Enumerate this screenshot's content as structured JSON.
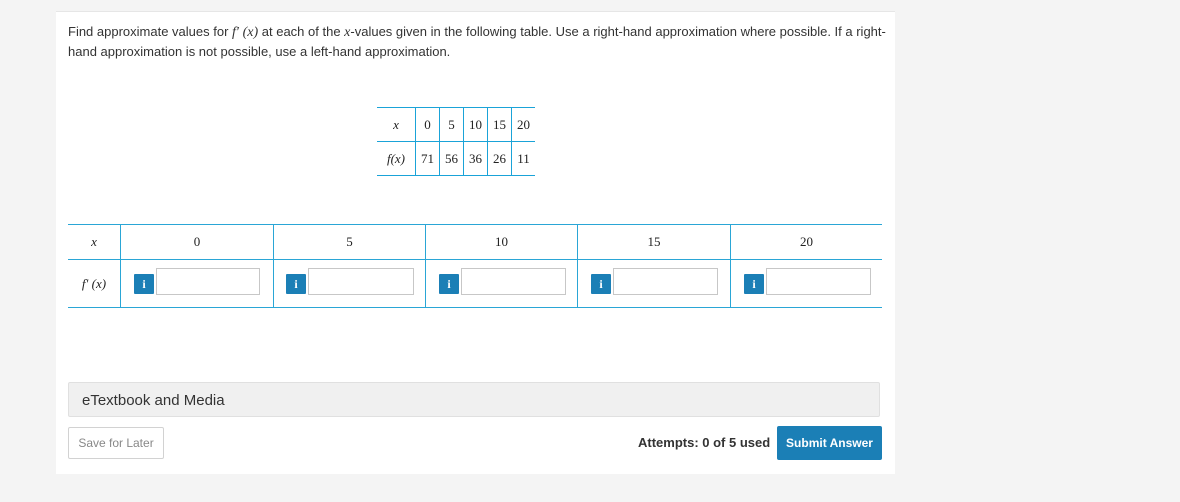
{
  "question": {
    "text_1": "Find approximate values for ",
    "fprime": "f′",
    "paren_x": "(x)",
    "text_2": " at each of the ",
    "xvar": "x",
    "text_3": "-values given in the following table. Use a right-hand approximation where possible. If a right-hand approximation is not possible, use a left-hand approximation."
  },
  "given_table": {
    "row_x_label": "x",
    "row_f_label": "f(x)",
    "x_values": [
      "0",
      "5",
      "10",
      "15",
      "20"
    ],
    "f_values": [
      "71",
      "56",
      "36",
      "26",
      "11"
    ]
  },
  "answer_grid": {
    "x_label": "x",
    "fprime_label": "f′ (x)",
    "columns": [
      "0",
      "5",
      "10",
      "15",
      "20"
    ],
    "info_label": "i",
    "inputs": [
      "",
      "",
      "",
      "",
      ""
    ]
  },
  "etextbook_label": "eTextbook and Media",
  "save_label": "Save for Later",
  "attempts": "Attempts: 0 of 5 used",
  "submit_label": "Submit Answer",
  "colors": {
    "accent": "#1b7fb6",
    "grid_line": "#2aa6d6"
  }
}
